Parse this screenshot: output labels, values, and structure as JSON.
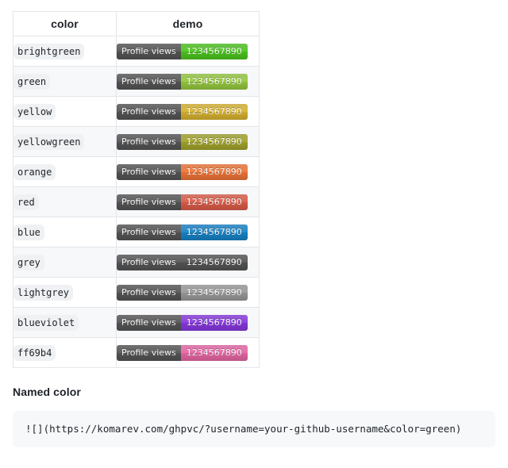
{
  "table": {
    "headers": [
      "color",
      "demo"
    ],
    "badge_label": "Profile views",
    "badge_value": "1234567890",
    "rows": [
      {
        "name": "brightgreen",
        "hex": "#4CC71E"
      },
      {
        "name": "green",
        "hex": "#97CA3F"
      },
      {
        "name": "yellow",
        "hex": "#D9B430"
      },
      {
        "name": "yellowgreen",
        "hex": "#A3A52C"
      },
      {
        "name": "orange",
        "hex": "#F07537"
      },
      {
        "name": "red",
        "hex": "#DD5C49"
      },
      {
        "name": "blue",
        "hex": "#1784C8"
      },
      {
        "name": "grey",
        "hex": "#555555"
      },
      {
        "name": "lightgrey",
        "hex": "#9B9B9B"
      },
      {
        "name": "blueviolet",
        "hex": "#8838E0"
      },
      {
        "name": "ff69b4",
        "hex": "#E867A6"
      }
    ]
  },
  "section": {
    "heading": "Named color",
    "code": "![](https://komarev.com/ghpvc/?username=your-github-username&color=green)"
  }
}
